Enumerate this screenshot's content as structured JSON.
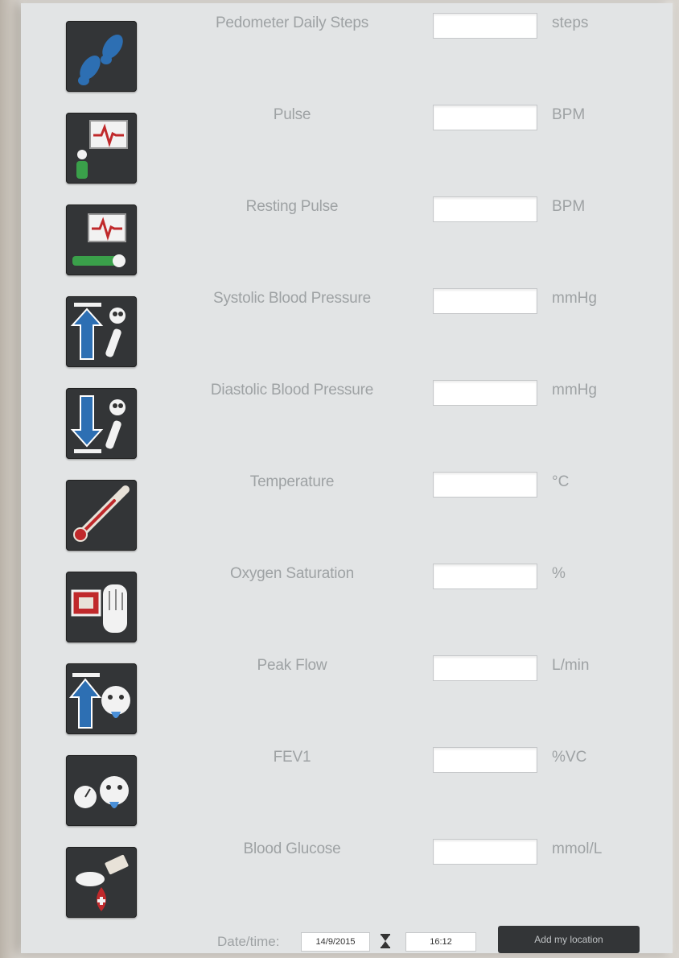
{
  "measurements": [
    {
      "label": "Pedometer Daily Steps",
      "unit": "steps",
      "value": "",
      "icon": "footprints-icon"
    },
    {
      "label": "Pulse",
      "unit": "BPM",
      "value": "",
      "icon": "pulse-monitor-icon"
    },
    {
      "label": "Resting Pulse",
      "unit": "BPM",
      "value": "",
      "icon": "resting-pulse-icon"
    },
    {
      "label": "Systolic Blood Pressure",
      "unit": "mmHg",
      "value": "",
      "icon": "systolic-pressure-icon"
    },
    {
      "label": "Diastolic Blood Pressure",
      "unit": "mmHg",
      "value": "",
      "icon": "diastolic-pressure-icon"
    },
    {
      "label": "Temperature",
      "unit": "°C",
      "value": "",
      "icon": "thermometer-icon"
    },
    {
      "label": "Oxygen Saturation",
      "unit": "%",
      "value": "",
      "icon": "oximeter-icon"
    },
    {
      "label": "Peak Flow",
      "unit": "L/min",
      "value": "",
      "icon": "peak-flow-icon"
    },
    {
      "label": "FEV1",
      "unit": "%VC",
      "value": "",
      "icon": "fev1-icon"
    },
    {
      "label": "Blood Glucose",
      "unit": "mmol/L",
      "value": "",
      "icon": "blood-glucose-icon"
    }
  ],
  "footer": {
    "datetime_label": "Date/time:",
    "date_value": "14/9/2015",
    "time_value": "16:12",
    "location_button": "Add my location"
  }
}
